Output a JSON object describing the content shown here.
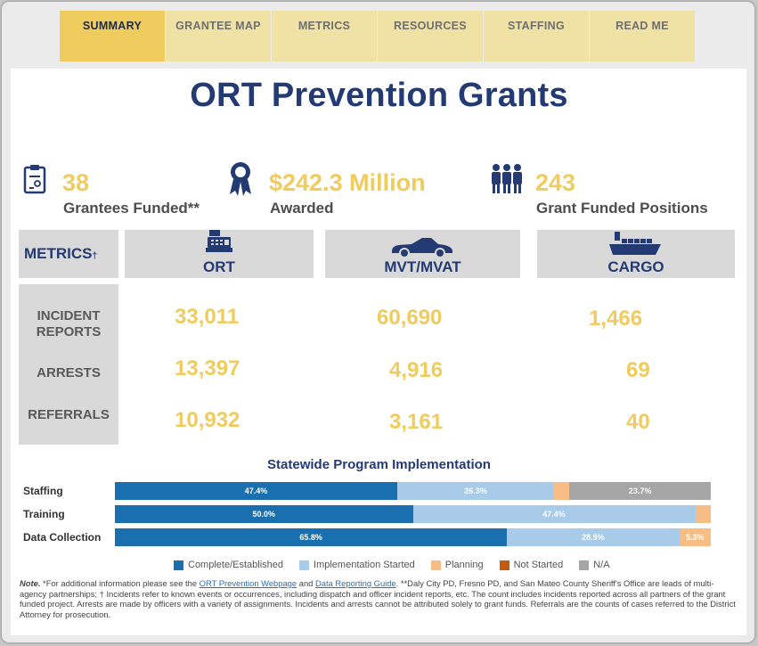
{
  "tabs": [
    {
      "label": "SUMMARY",
      "active": true
    },
    {
      "label": "GRANTEE MAP",
      "active": false
    },
    {
      "label": "METRICS",
      "active": false
    },
    {
      "label": "RESOURCES",
      "active": false
    },
    {
      "label": "STAFFING",
      "active": false
    },
    {
      "label": "READ ME",
      "active": false
    }
  ],
  "title": "ORT Prevention Grants",
  "stats": [
    {
      "icon": "clipboard-icon",
      "number": "38",
      "label": "Grantees Funded**"
    },
    {
      "icon": "award-ribbon-icon",
      "number": "$242.3 Million",
      "label": "Awarded"
    },
    {
      "icon": "people-group-icon",
      "number": "243",
      "label": "Grant Funded Positions"
    }
  ],
  "metrics": {
    "header": "METRICS",
    "dagger": "†",
    "columns": [
      {
        "label": "ORT",
        "icon": "cash-register-icon"
      },
      {
        "label": "MVT/MVAT",
        "icon": "car-icon"
      },
      {
        "label": "CARGO",
        "icon": "cargo-ship-icon"
      }
    ],
    "rows": [
      {
        "label": "INCIDENT REPORTS",
        "values": [
          "33,011",
          "60,690",
          "1,466"
        ]
      },
      {
        "label": "ARRESTS",
        "values": [
          "13,397",
          "4,916",
          "69"
        ]
      },
      {
        "label": "REFERRALS",
        "values": [
          "10,932",
          "3,161",
          "40"
        ]
      }
    ]
  },
  "chart_data": {
    "type": "bar",
    "orientation": "horizontal",
    "stacked": true,
    "title": "Statewide Program Implementation",
    "categories": [
      "Staffing",
      "Training",
      "Data Collection"
    ],
    "series": [
      {
        "name": "Complete/Established",
        "color": "#1a6fae",
        "values": [
          47.4,
          50.0,
          65.8
        ],
        "labels": [
          "47.4%",
          "50.0%",
          "65.8%"
        ]
      },
      {
        "name": "Implementation Started",
        "color": "#a7cbe8",
        "values": [
          26.3,
          47.4,
          28.9
        ],
        "labels": [
          "26.3%",
          "47.4%",
          "28.9%"
        ]
      },
      {
        "name": "Planning",
        "color": "#f7bd84",
        "values": [
          2.6,
          2.6,
          5.3
        ],
        "labels": [
          "",
          "",
          "5.3%"
        ]
      },
      {
        "name": "Not Started",
        "color": "#c55a11",
        "values": [
          0,
          0,
          0
        ],
        "labels": [
          "",
          "",
          ""
        ]
      },
      {
        "name": "N/A",
        "color": "#a6a6a6",
        "values": [
          23.7,
          0,
          0
        ],
        "labels": [
          "23.7%",
          "",
          ""
        ]
      }
    ],
    "xlim": [
      0,
      100
    ],
    "legend": "bottom"
  },
  "note": {
    "prefix": "Note.",
    "text1": " *For additional information please see the ",
    "link1": "ORT Prevention Webpage",
    "text2": " and ",
    "link2": "Data Reporting Guide",
    "text3": ". **Daly City PD, Fresno PD, and San Mateo County Sheriff's Office are leads of multi-agency partnerships; † Incidents refer to known events or occurrences, including dispatch and officer incident reports, etc. The count includes incidents reported across all partners of the grant funded project. Arrests are made by officers with a variety of assignments. Incidents and arrests cannot be attributed solely to grant funds. Referrals are the counts of cases referred to the District Attorney for prosecution."
  }
}
